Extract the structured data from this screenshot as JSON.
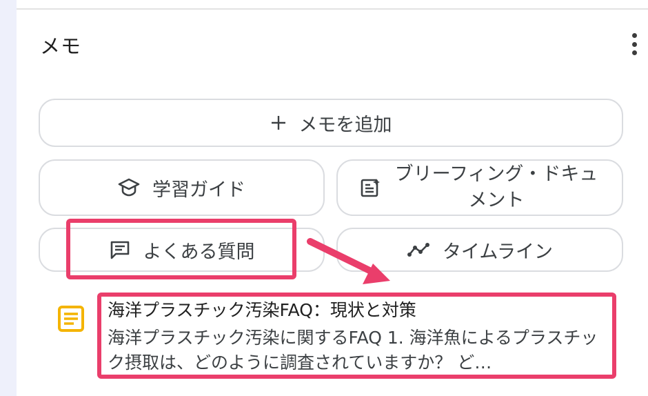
{
  "notes_panel": {
    "title": "メモ",
    "menu_icon": "more-vert-icon",
    "add_note_label": "メモを追加",
    "actions": {
      "study_guide": "学習ガイド",
      "briefing_doc": "ブリーフィング・ドキュメント",
      "faq": "よくある質問",
      "timeline": "タイムライン"
    },
    "note": {
      "title": "海洋プラスチック汚染FAQ：現状と対策",
      "preview": "海洋プラスチック汚染に関するFAQ 1. 海洋魚によるプラスチック摂取は、どのように調査されていますか？ ど…"
    }
  },
  "annotations": {
    "highlight_color": "#ea3e6b"
  }
}
